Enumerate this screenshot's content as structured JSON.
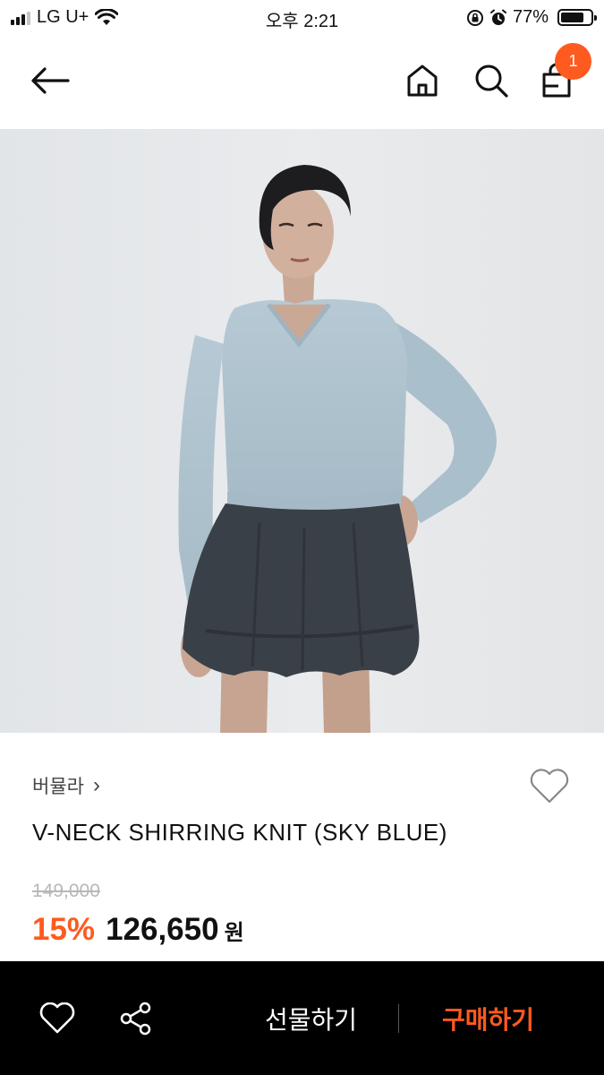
{
  "status_bar": {
    "carrier": "LG U+",
    "time": "오후 2:21",
    "battery": "77%",
    "battery_level": 0.77
  },
  "nav": {
    "cart_count": "1",
    "icons": [
      "back-arrow-icon",
      "home-icon",
      "search-icon",
      "shopping-bag-icon"
    ]
  },
  "product": {
    "brand": "버뮬라",
    "brand_chevron": "›",
    "name": "V-NECK SHIRRING KNIT (SKY BLUE)",
    "original_price": "149,000",
    "discount": "15%",
    "sale_price": "126,650",
    "currency": "원"
  },
  "bottom_bar": {
    "gift_label": "선물하기",
    "buy_label": "구매하기",
    "icons": [
      "heart-icon",
      "share-icon"
    ]
  },
  "colors": {
    "accent": "#ff5a1f",
    "bottom_bar": "#000000",
    "strikethrough": "#b8b8b8"
  }
}
